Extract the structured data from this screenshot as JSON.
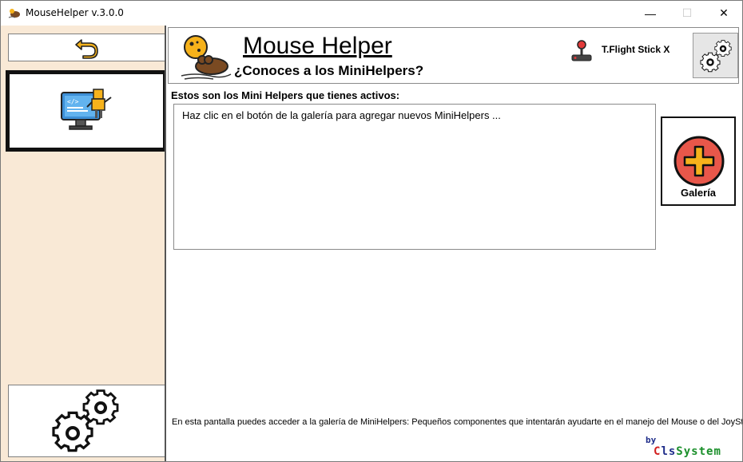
{
  "window": {
    "title": "MouseHelper v.3.0.0",
    "controls": {
      "minimize": "—",
      "maximize": "☐",
      "close": "✕"
    }
  },
  "sidebar": {
    "back_icon": "undo-arrow-icon",
    "developer_icon": "developer-monitor-icon",
    "settings_icon": "gears-icon"
  },
  "header": {
    "title": "Mouse Helper",
    "subtitle": "¿Conoces a los MiniHelpers?",
    "joystick_name": "T.Flight Stick X",
    "settings_icon": "gears-icon"
  },
  "main": {
    "section_label": "Estos son los Mini Helpers que tienes activos:",
    "list_hint": "Haz clic en el botón de la galería para agregar nuevos MiniHelpers ...",
    "gallery_label": "Galería",
    "footer_text": "En esta pantalla puedes acceder a la galería de MiniHelpers: Pequeños componentes que intentarán ayudarte en el manejo del Mouse o del JoyStick",
    "by_label": "by",
    "brand": {
      "part1": "C",
      "part2": "ls",
      "part3": "System"
    }
  },
  "colors": {
    "sidebar_bg": "#f9e9d6",
    "accent_yellow": "#f6b21b",
    "gallery_red": "#e8574a",
    "brand_red": "#d21f1f",
    "brand_blue": "#1f2d8a",
    "brand_green": "#1a8f2a"
  }
}
